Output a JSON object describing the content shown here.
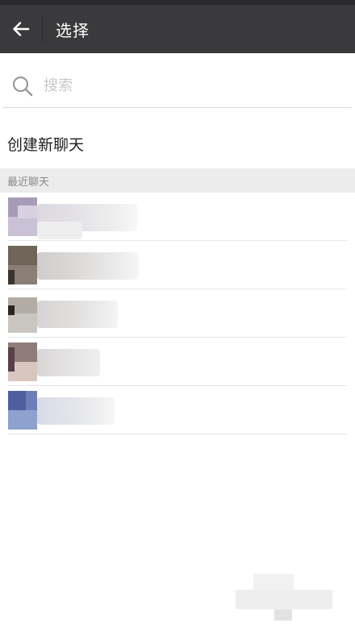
{
  "header": {
    "title": "选择"
  },
  "search": {
    "placeholder": "搜索"
  },
  "new_chat": {
    "label": "创建新聊天"
  },
  "recent": {
    "header": "最近聊天"
  },
  "colors": {
    "titlebar": "#3a3a3c",
    "section_bg": "#ececec",
    "divider": "#e6e6e6"
  },
  "icons": {
    "back": "arrow-left-icon",
    "search": "search-icon"
  }
}
